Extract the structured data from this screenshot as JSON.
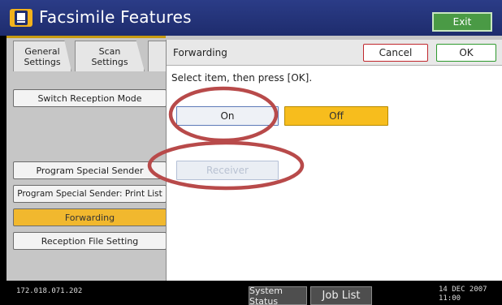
{
  "app": {
    "title": "Facsimile Features",
    "exit_label": "Exit",
    "icon": "fax-icon"
  },
  "tabs": [
    {
      "label_line1": "General",
      "label_line2": "Settings"
    },
    {
      "label_line1": "Scan",
      "label_line2": "Settings"
    }
  ],
  "sidebar": {
    "items": [
      {
        "label": "Switch Reception Mode"
      },
      {
        "label": "Program Special Sender"
      },
      {
        "label": "Program Special Sender: Print List"
      },
      {
        "label": "Forwarding",
        "selected": true
      },
      {
        "label": "Reception File Setting"
      }
    ]
  },
  "dialog": {
    "title": "Forwarding",
    "cancel_label": "Cancel",
    "ok_label": "OK",
    "instruction": "Select item, then press [OK].",
    "options": {
      "on_label": "On",
      "off_label": "Off",
      "selected": "Off"
    },
    "receiver_label": "Receiver",
    "receiver_enabled": false
  },
  "status": {
    "ip": "172.018.071.202",
    "system_status_label": "System Status",
    "job_list_label": "Job List",
    "date": "14 DEC  2007",
    "time": "11:00"
  },
  "colors": {
    "titlebar": "#2b3c87",
    "selected": "#f1b82e",
    "annotation": "#b84a4a"
  }
}
